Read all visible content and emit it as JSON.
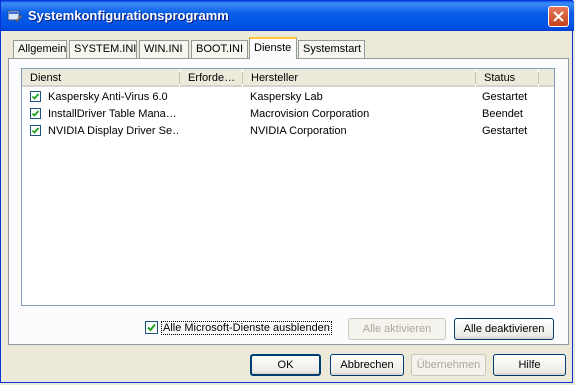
{
  "window": {
    "title": "Systemkonfigurationsprogramm",
    "icon": "msconfig-icon",
    "close_icon": "close-icon"
  },
  "tabs": [
    {
      "label": "Allgemein"
    },
    {
      "label": "SYSTEM.INI"
    },
    {
      "label": "WIN.INI"
    },
    {
      "label": "BOOT.INI"
    },
    {
      "label": "Dienste",
      "active": true
    },
    {
      "label": "Systemstart"
    }
  ],
  "services": {
    "columns": [
      "Dienst",
      "Erforde…",
      "Hersteller",
      "Status"
    ],
    "rows": [
      {
        "checked": true,
        "name": "Kaspersky Anti-Virus 6.0",
        "required": "",
        "vendor": "Kaspersky Lab",
        "status": "Gestartet"
      },
      {
        "checked": true,
        "name": "InstallDriver Table Mana…",
        "required": "",
        "vendor": "Macrovision Corporation",
        "status": "Beendet"
      },
      {
        "checked": true,
        "name": "NVIDIA Display Driver Se…",
        "required": "",
        "vendor": "NVIDIA Corporation",
        "status": "Gestartet"
      }
    ]
  },
  "options": {
    "hide_ms_label": "Alle Microsoft-Dienste ausblenden",
    "hide_ms_checked": true,
    "enable_all_label": "Alle aktivieren",
    "disable_all_label": "Alle deaktivieren"
  },
  "footer": {
    "ok_label": "OK",
    "cancel_label": "Abbrechen",
    "apply_label": "Übernehmen",
    "help_label": "Hilfe"
  },
  "colors": {
    "titlebar": "#0a5ee8",
    "active_tab_accent": "#ffc83c",
    "window_bg": "#ece9d8"
  }
}
